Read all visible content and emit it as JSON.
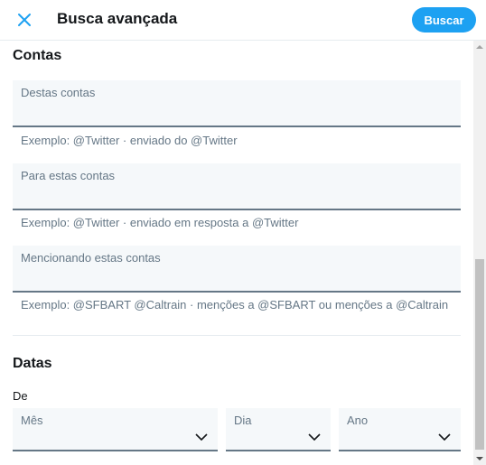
{
  "header": {
    "title": "Busca avançada",
    "search_button": "Buscar",
    "close_icon": "close-x-icon"
  },
  "accounts": {
    "section_title": "Contas",
    "fields": [
      {
        "label": "Destas contas",
        "hint": "Exemplo: @Twitter · enviado do @Twitter"
      },
      {
        "label": "Para estas contas",
        "hint": "Exemplo: @Twitter · enviado em resposta a @Twitter"
      },
      {
        "label": "Mencionando estas contas",
        "hint": "Exemplo: @SFBART @Caltrain · menções a @SFBART ou menções a @Caltrain"
      }
    ]
  },
  "dates": {
    "section_title": "Datas",
    "from_label": "De",
    "selects": [
      {
        "label": "Mês"
      },
      {
        "label": "Dia"
      },
      {
        "label": "Ano"
      }
    ]
  },
  "colors": {
    "accent": "#1da1f2",
    "field_bg": "#f5f8fa",
    "muted_text": "#657786"
  }
}
